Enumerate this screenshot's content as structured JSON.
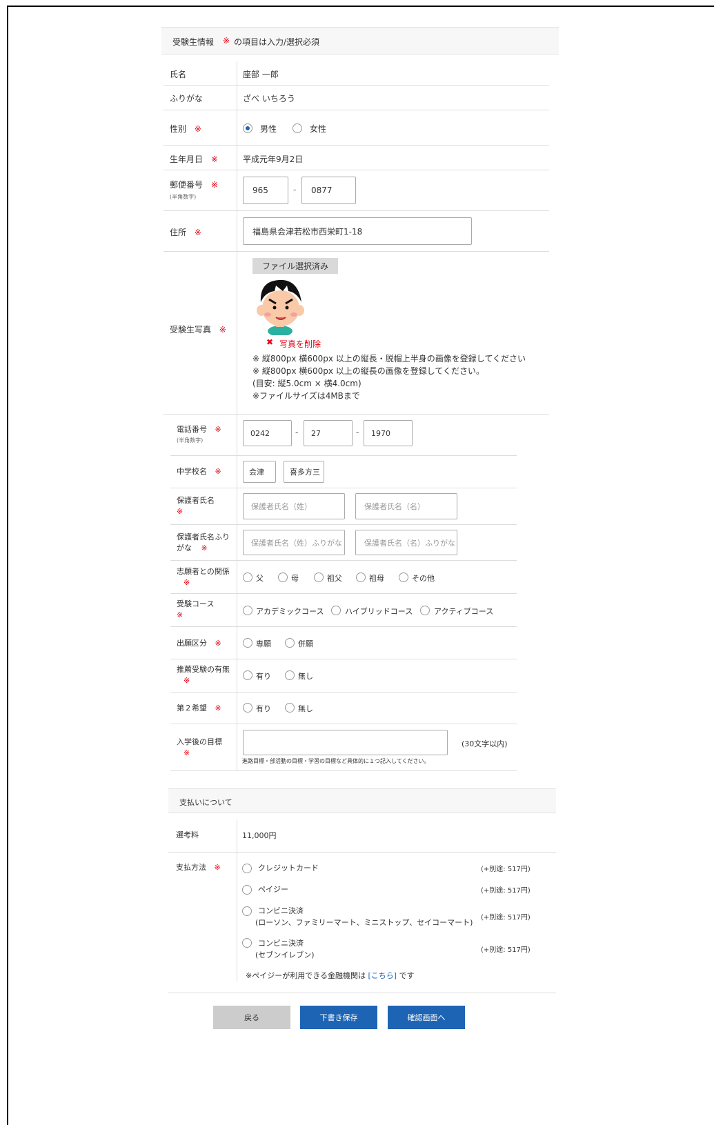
{
  "section1": {
    "title": "受験生情報",
    "required_note": "の項目は入力/選択必須",
    "required_mark": "※"
  },
  "fields": {
    "name": {
      "label": "氏名",
      "value": "座部 一郎"
    },
    "furigana": {
      "label": "ふりがな",
      "value": "ざべ いちろう"
    },
    "gender": {
      "label": "性別",
      "options": [
        "男性",
        "女性"
      ],
      "selected": "男性"
    },
    "birthdate": {
      "label": "生年月日",
      "value": "平成元年9月2日"
    },
    "postal": {
      "label": "郵便番号",
      "note": "(半角数字)",
      "part1": "965",
      "part2": "0877",
      "separator": "-"
    },
    "address": {
      "label": "住所",
      "value": "福島県会津若松市西栄町1-18"
    },
    "photo": {
      "label": "受験生写真",
      "file_button": "ファイル選択済み",
      "delete_mark": "✖",
      "delete_label": "写真を削除",
      "notes": [
        "※ 縦800px 横600px 以上の縦長・脱帽上半身の画像を登録してください",
        "※ 縦800px 横600px 以上の縦長の画像を登録してください。",
        "(目安: 縦5.0cm × 横4.0cm)",
        "※ファイルサイズは4MBまで"
      ]
    },
    "phone": {
      "label": "電話番号",
      "note": "(半角数字)",
      "part1": "0242",
      "part2": "27",
      "part3": "1970"
    },
    "school": {
      "label": "中学校名",
      "part1": "会津",
      "part2": "喜多方三"
    },
    "guardian_name": {
      "label": "保護者氏名",
      "placeholder_last": "保護者氏名（姓）",
      "placeholder_first": "保護者氏名（名）"
    },
    "guardian_kana": {
      "label_line1": "保護者氏名ふり",
      "label_line2": "がな",
      "placeholder_last": "保護者氏名（姓）ふりがな",
      "placeholder_first": "保護者氏名（名）ふりがな"
    },
    "relation": {
      "label": "志願者との関係",
      "options": [
        "父",
        "母",
        "祖父",
        "祖母",
        "その他"
      ]
    },
    "course": {
      "label": "受験コース",
      "options": [
        "アカデミックコース",
        "ハイブリッドコース",
        "アクティブコース"
      ]
    },
    "category": {
      "label": "出願区分",
      "options": [
        "専願",
        "併願"
      ]
    },
    "recommend": {
      "label": "推薦受験の有無",
      "options": [
        "有り",
        "無し"
      ]
    },
    "second_choice": {
      "label": "第２希望",
      "options": [
        "有り",
        "無し"
      ]
    },
    "goal": {
      "label": "入学後の目標",
      "limit": "(30文字以内)",
      "hint": "進路目標・部活動の目標・学習の目標など具体的に１つ記入してください。"
    }
  },
  "payment": {
    "title": "支払いについて",
    "fee_label": "選考料",
    "fee_value": "11,000円",
    "method_label": "支払方法",
    "methods": [
      {
        "name": "クレジットカード",
        "sub": "",
        "extra": "(+別途: 517円)"
      },
      {
        "name": "ペイジー",
        "sub": "",
        "extra": "(+別途: 517円)"
      },
      {
        "name": "コンビニ決済",
        "sub": "(ローソン、ファミリーマート、ミニストップ、セイコーマート)",
        "extra": "(+別途: 517円)"
      },
      {
        "name": "コンビニ決済",
        "sub": "(セブンイレブン)",
        "extra": "(+別途: 517円)"
      }
    ],
    "note_prefix": "※ペイジーが利用できる金融機関は",
    "note_link": "[こちら]",
    "note_suffix": "です"
  },
  "buttons": {
    "back": "戻る",
    "draft": "下書き保存",
    "confirm": "確認画面へ"
  },
  "colors": {
    "required": "#e60012",
    "primary": "#1e64b4",
    "secondary": "#cccccc"
  }
}
